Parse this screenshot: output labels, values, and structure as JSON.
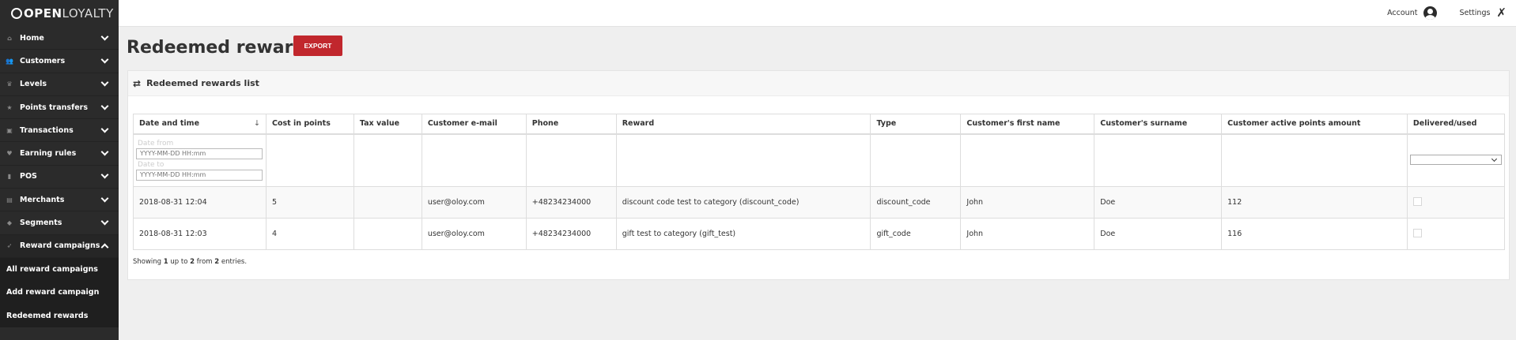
{
  "brand": {
    "open": "OPEN",
    "loyalty": "LOYALTY"
  },
  "sidebar": {
    "items": [
      {
        "label": "Home",
        "icon": "home-icon",
        "glyph": "⌂"
      },
      {
        "label": "Customers",
        "icon": "users-icon",
        "glyph": "👥"
      },
      {
        "label": "Levels",
        "icon": "trophy-icon",
        "glyph": "♛"
      },
      {
        "label": "Points transfers",
        "icon": "star-icon",
        "glyph": "★"
      },
      {
        "label": "Transactions",
        "icon": "briefcase-icon",
        "glyph": "▣"
      },
      {
        "label": "Earning rules",
        "icon": "heart-icon",
        "glyph": "♥"
      },
      {
        "label": "POS",
        "icon": "pos-icon",
        "glyph": "▮"
      },
      {
        "label": "Merchants",
        "icon": "card-icon",
        "glyph": "▤"
      },
      {
        "label": "Segments",
        "icon": "segments-icon",
        "glyph": "◆"
      },
      {
        "label": "Reward campaigns",
        "icon": "rocket-icon",
        "glyph": "➶"
      }
    ],
    "sub_items": [
      {
        "label": "All reward campaigns"
      },
      {
        "label": "Add reward campaign"
      },
      {
        "label": "Redeemed rewards"
      }
    ]
  },
  "topbar": {
    "account_label": "Account",
    "settings_label": "Settings"
  },
  "page": {
    "title": "Redeemed rewards",
    "export_label": "EXPORT"
  },
  "panel": {
    "title": "Redeemed rewards list"
  },
  "table": {
    "columns": [
      "Date and time",
      "Cost in points",
      "Tax value",
      "Customer e-mail",
      "Phone",
      "Reward",
      "Type",
      "Customer's first name",
      "Customer's surname",
      "Customer active points amount",
      "Delivered/used"
    ],
    "sort_indicator": "↓",
    "filters": {
      "date_from_label": "Date from",
      "date_to_label": "Date to",
      "date_placeholder": "YYYY-MM-DD HH:mm",
      "delivered_selected": ""
    },
    "rows": [
      [
        "2018-08-31 12:04",
        "5",
        "",
        "user@oloy.com",
        "+48234234000",
        "discount code test to category (discount_code)",
        "discount_code",
        "John",
        "Doe",
        "112"
      ],
      [
        "2018-08-31 12:03",
        "4",
        "",
        "user@oloy.com",
        "+48234234000",
        "gift test to category (gift_test)",
        "gift_code",
        "John",
        "Doe",
        "116"
      ]
    ],
    "delivered": [
      false,
      false
    ]
  },
  "info": {
    "prefix": "Showing",
    "from": "1",
    "mid": "up to",
    "to": "2",
    "mid2": "from",
    "total": "2",
    "suffix": "entries."
  }
}
